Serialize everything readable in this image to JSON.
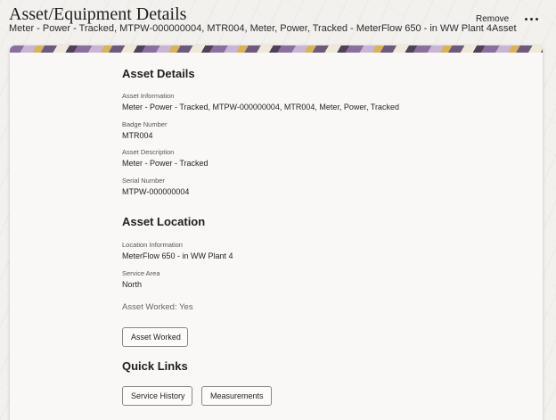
{
  "header": {
    "title": "Asset/Equipment Details",
    "subtitle": "Meter - Power - Tracked, MTPW-000000004, MTR004, Meter, Power, Tracked - MeterFlow 650 - in WW Plant 4Asset",
    "remove_label": "Remove",
    "more_icon": "ellipsis-horizontal-icon"
  },
  "asset_details": {
    "title": "Asset Details",
    "fields": [
      {
        "label": "Asset Information",
        "value": "Meter - Power - Tracked, MTPW-000000004, MTR004, Meter, Power, Tracked"
      },
      {
        "label": "Badge Number",
        "value": "MTR004"
      },
      {
        "label": "Asset Description",
        "value": "Meter - Power - Tracked"
      },
      {
        "label": "Serial Number",
        "value": "MTPW-000000004"
      }
    ]
  },
  "asset_location": {
    "title": "Asset Location",
    "fields": [
      {
        "label": "Location Information",
        "value": "MeterFlow 650 - in WW Plant 4"
      },
      {
        "label": "Service Area",
        "value": "North"
      }
    ]
  },
  "asset_worked": {
    "status_text": "Asset Worked: Yes",
    "button_label": "Asset Worked"
  },
  "quick_links": {
    "title": "Quick Links",
    "service_history_label": "Service History",
    "measurements_label": "Measurements"
  }
}
